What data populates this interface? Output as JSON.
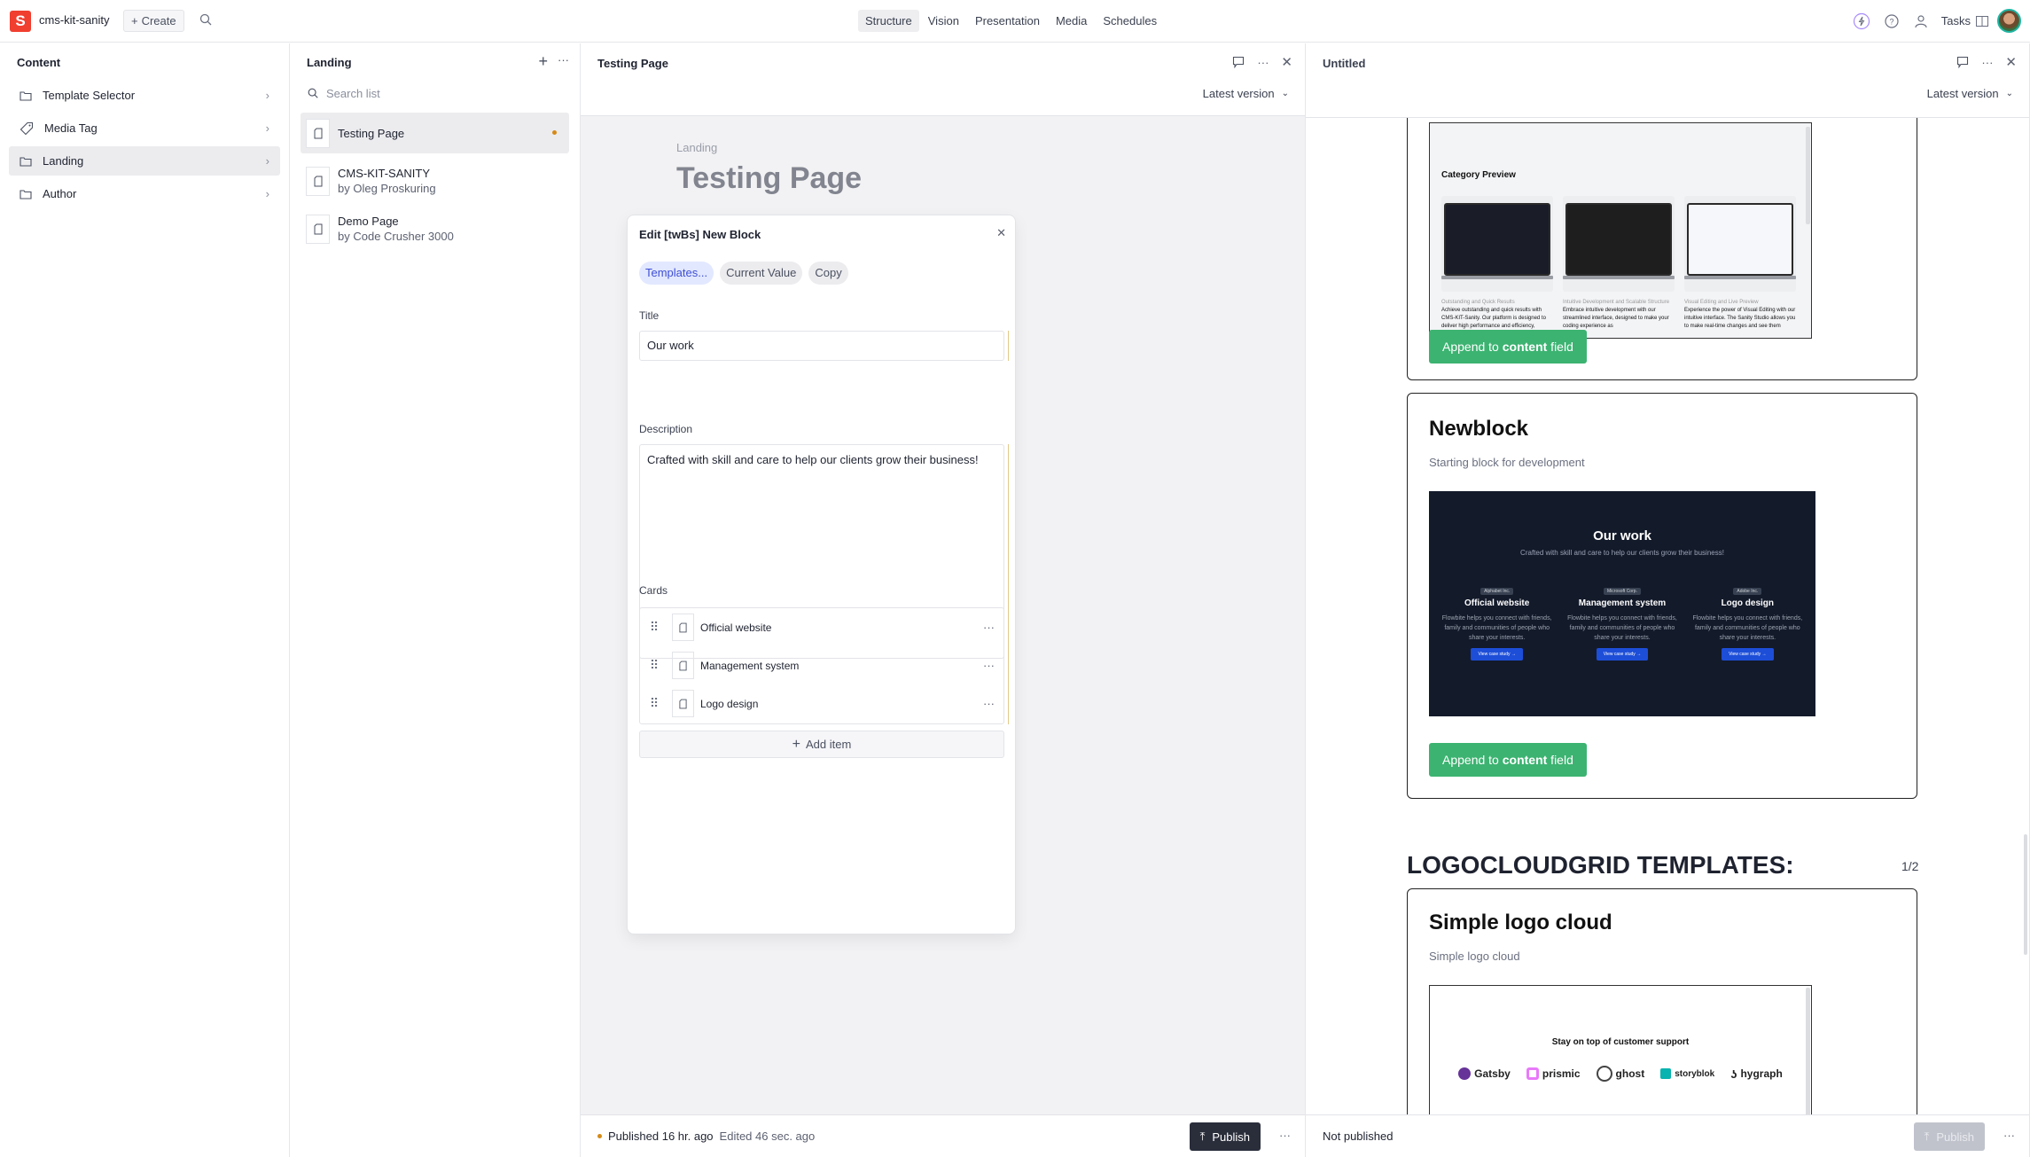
{
  "navbar": {
    "logo_letter": "S",
    "project": "cms-kit-sanity",
    "create_label": "Create",
    "tools": [
      "Structure",
      "Vision",
      "Presentation",
      "Media",
      "Schedules"
    ],
    "active_tool": "Structure",
    "tasks_label": "Tasks"
  },
  "content_pane": {
    "title": "Content",
    "items": [
      {
        "label": "Template Selector",
        "icon": "folder-icon"
      },
      {
        "label": "Media Tag",
        "icon": "tag-icon"
      },
      {
        "label": "Landing",
        "icon": "folder-icon",
        "selected": true
      },
      {
        "label": "Author",
        "icon": "folder-icon"
      }
    ]
  },
  "landing_pane": {
    "title": "Landing",
    "search_placeholder": "Search list",
    "docs": [
      {
        "title": "Testing Page",
        "subtitle": "",
        "selected": true,
        "status": "edited"
      },
      {
        "title": "CMS-KIT-SANITY",
        "subtitle": "by Oleg Proskuring"
      },
      {
        "title": "Demo Page",
        "subtitle": "by Code Crusher 3000"
      }
    ]
  },
  "editor_pane": {
    "title": "Testing Page",
    "version_label": "Latest version",
    "breadcrumb": "Landing",
    "page_title": "Testing Page",
    "modal": {
      "title": "Edit [twBs] New Block",
      "chips": [
        "Templates...",
        "Current Value",
        "Copy"
      ],
      "title_label": "Title",
      "title_value": "Our work",
      "description_label": "Description",
      "description_value": "Crafted with skill and care to help our clients grow their business!",
      "cards_label": "Cards",
      "cards": [
        "Official website",
        "Management system",
        "Logo design"
      ],
      "add_item_label": "Add item"
    },
    "footer": {
      "published": "Published 16 hr. ago",
      "edited": "Edited 46 sec. ago",
      "publish_label": "Publish"
    }
  },
  "untitled_pane": {
    "title": "Untitled",
    "version_label": "Latest version",
    "category_preview": {
      "heading": "Category Preview",
      "items": [
        {
          "kicker": "Outstanding and Quick Results",
          "text": "Achieve outstanding and quick results with CMS-KIT-Sanity. Our platform is designed to deliver high performance and efficiency, ensuring"
        },
        {
          "kicker": "Intuitive Development and Scalable Structure",
          "text": "Embrace intuitive development with our streamlined interface, designed to make your coding experience as"
        },
        {
          "kicker": "Visual Editing and Live Preview",
          "text": "Experience the power of Visual Editing with our intuitive interface. The Sanity Studio allows you to make real-time changes and see them"
        }
      ]
    },
    "append_label_pre": "Append to ",
    "append_label_bold": "content",
    "append_label_post": " field",
    "newblock": {
      "title": "Newblock",
      "description": "Starting block for development",
      "preview": {
        "heading": "Our work",
        "sub": "Crafted with skill and care to help our clients grow their business!",
        "cols": [
          {
            "badge": "Alphabet Inc.",
            "title": "Official website",
            "text": "Flowbite helps you connect with friends, family and communities of people who share your interests.",
            "btn": "View case study →"
          },
          {
            "badge": "Microsoft Corp.",
            "title": "Management system",
            "text": "Flowbite helps you connect with friends, family and communities of people who share your interests.",
            "btn": "View case study →"
          },
          {
            "badge": "Adobe Inc.",
            "title": "Logo design",
            "text": "Flowbite helps you connect with friends, family and communities of people who share your interests.",
            "btn": "View case study →"
          }
        ]
      }
    },
    "section_heading": "LOGOCLOUDGRID TEMPLATES:",
    "pager": "1/2",
    "logocloud": {
      "title": "Simple logo cloud",
      "description": "Simple logo cloud",
      "preview_heading": "Stay on top of customer support",
      "logos": [
        "Gatsby",
        "prismic",
        "ghost",
        "storyblok",
        "hygraph"
      ]
    },
    "footer": {
      "status": "Not published",
      "publish_label": "Publish"
    }
  },
  "colors": {
    "brand": "#f03e2f",
    "append_green": "#3cb371",
    "edited_dot": "#d68a16",
    "primary_chip": "#3e4fd4"
  }
}
